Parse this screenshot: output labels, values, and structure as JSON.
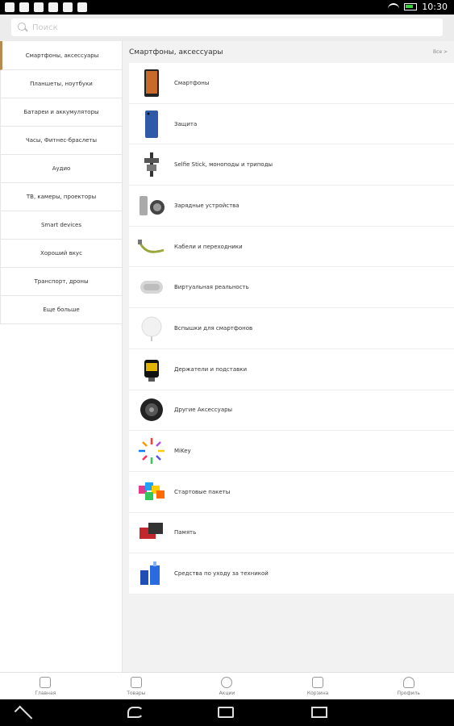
{
  "statusbar": {
    "time": "10:30"
  },
  "search": {
    "placeholder": "Поиск"
  },
  "sidebar": {
    "items": [
      {
        "label": "Смартфоны, аксессуары"
      },
      {
        "label": "Планшеты, ноутбуки"
      },
      {
        "label": "Батареи и аккумуляторы"
      },
      {
        "label": "Часы, Фитнес-браслеты"
      },
      {
        "label": "Аудио"
      },
      {
        "label": "TB, камеры, проекторы"
      },
      {
        "label": "Smart devices"
      },
      {
        "label": "Хороший вкус"
      },
      {
        "label": "Транспорт, дроны"
      },
      {
        "label": "Еще больше"
      }
    ]
  },
  "main": {
    "title": "Смартфоны, аксессуары",
    "all_label": "Все >",
    "items": [
      {
        "label": "Смартфоны",
        "icon": "smartphone-icon",
        "color": "#333333"
      },
      {
        "label": "Защита",
        "icon": "case-icon",
        "color": "#2f5aa8"
      },
      {
        "label": "Selfie Stick, моноподы и триподы",
        "icon": "selfie-stick-icon",
        "color": "#444444"
      },
      {
        "label": "Зарядные устройства",
        "icon": "charger-icon",
        "color": "#777777"
      },
      {
        "label": "Кабели и переходники",
        "icon": "cable-icon",
        "color": "#9aa63a"
      },
      {
        "label": "Виртуальная реальность",
        "icon": "vr-headset-icon",
        "color": "#cfcfcf"
      },
      {
        "label": "Вспышки для смартфонов",
        "icon": "flash-icon",
        "color": "#e8e8e8"
      },
      {
        "label": "Держатели и подставки",
        "icon": "holder-icon",
        "color": "#e0b400"
      },
      {
        "label": "Другие Аксессуары",
        "icon": "lens-icon",
        "color": "#222222"
      },
      {
        "label": "MiKey",
        "icon": "mikey-icon",
        "color": "#ff6a00"
      },
      {
        "label": "Стартовые пакеты",
        "icon": "starter-pack-icon",
        "color": "#e33b8a"
      },
      {
        "label": "Память",
        "icon": "memory-card-icon",
        "color": "#c1272d"
      },
      {
        "label": "Средства по уходу за техникой",
        "icon": "cleaning-icon",
        "color": "#1f4fb3"
      }
    ]
  },
  "bottomnav": {
    "items": [
      {
        "label": "Главная",
        "icon": "phone-icon"
      },
      {
        "label": "Товары",
        "icon": "list-icon"
      },
      {
        "label": "Акции",
        "icon": "medal-icon"
      },
      {
        "label": "Корзина",
        "icon": "bag-icon"
      },
      {
        "label": "Профиль",
        "icon": "user-icon"
      }
    ]
  },
  "colors": {
    "accent": "#b88a4e",
    "text": "#333333"
  }
}
